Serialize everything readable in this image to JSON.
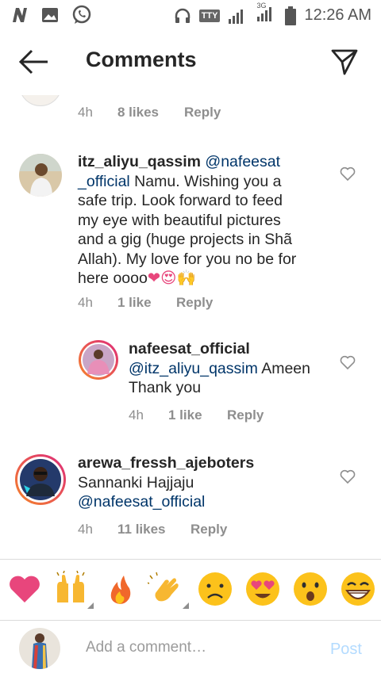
{
  "status_bar": {
    "time": "12:26 AM",
    "network_label": "TTY",
    "signal_label": "3G"
  },
  "header": {
    "title": "Comments"
  },
  "partial_comment": {
    "time": "4h",
    "likes": "8 likes",
    "reply": "Reply"
  },
  "comments": [
    {
      "username": "itz_aliyu_qassim",
      "mention": "@nafeesat\n_official",
      "text_line1": " Namu. Wishing you a",
      "text_rest": "safe trip. Look forward to feed\nmy eye with beautiful pictures\nand a gig (huge projects in Shã\nAllah). My love for you no be for\nhere oooo",
      "emojis": "❤😍🙌",
      "time": "4h",
      "likes": "1 like",
      "reply": "Reply"
    },
    {
      "username": "nafeesat_official",
      "mention": "@itz_aliyu_qassim",
      "text": " Ameen\nThank you",
      "time": "4h",
      "likes": "1 like",
      "reply": "Reply"
    },
    {
      "username": "arewa_fressh_ajeboters",
      "text": "Sannanki Hajjaju",
      "mention": "@nafeesat_official",
      "time": "4h",
      "likes": "11 likes",
      "reply": "Reply"
    }
  ],
  "composer": {
    "placeholder": "Add a comment…",
    "post_label": "Post"
  },
  "colors": {
    "mention": "#003569",
    "muted": "#8e8e8e",
    "post_disabled": "#b3dbff",
    "story_ring_start": "#f58529",
    "story_ring_end": "#dd2a7b"
  }
}
